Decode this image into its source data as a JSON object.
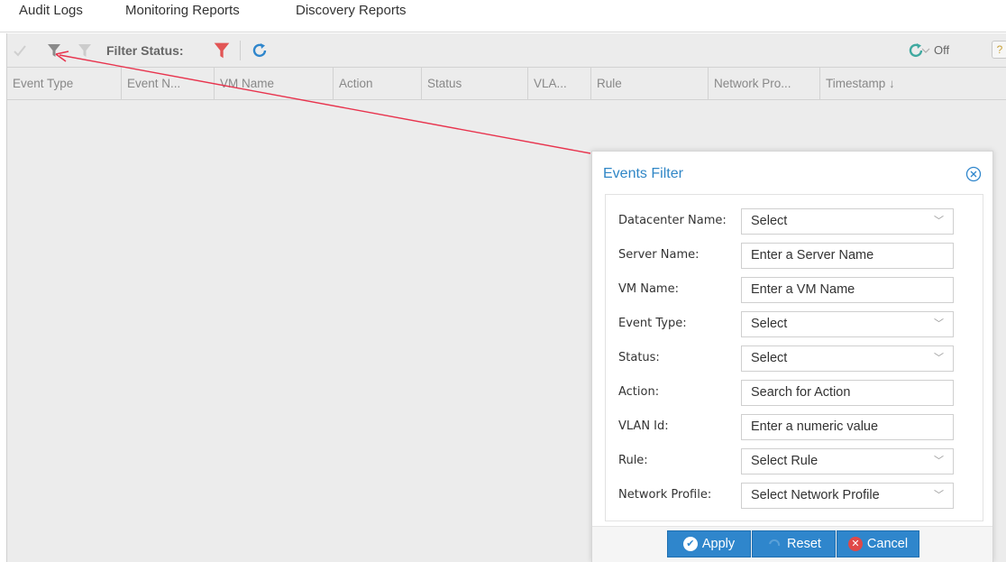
{
  "topnav": {
    "tabs": [
      "Audit Logs",
      "Monitoring Reports",
      "Discovery Reports"
    ]
  },
  "toolbar": {
    "filter_status_label": "Filter Status:",
    "off_label": "Off",
    "help_label": "?",
    "icons": [
      "checkmark-icon",
      "filter-icon",
      "clear-filter-icon",
      "red-filter-icon",
      "refresh-icon",
      "auto-refresh-icon"
    ]
  },
  "grid": {
    "columns": [
      "Event Type",
      "Event N...",
      "VM Name",
      "Action",
      "Status",
      "VLA...",
      "Rule",
      "Network Pro...",
      "Timestamp ↓"
    ]
  },
  "dialog": {
    "title": "Events Filter",
    "fields": [
      {
        "label": "Datacenter Name:",
        "value": "Select",
        "type": "select"
      },
      {
        "label": "Server Name:",
        "value": "Enter a Server Name",
        "type": "input"
      },
      {
        "label": "VM Name:",
        "value": "Enter a VM Name",
        "type": "input"
      },
      {
        "label": "Event Type:",
        "value": "Select",
        "type": "select"
      },
      {
        "label": "Status:",
        "value": "Select",
        "type": "select"
      },
      {
        "label": "Action:",
        "value": "Search for Action",
        "type": "input"
      },
      {
        "label": "VLAN Id:",
        "value": "Enter a numeric value",
        "type": "input"
      },
      {
        "label": "Rule:",
        "value": "Select Rule",
        "type": "select"
      },
      {
        "label": "Network Profile:",
        "value": "Select Network Profile",
        "type": "select"
      }
    ],
    "buttons": {
      "apply": "Apply",
      "reset": "Reset",
      "cancel": "Cancel"
    }
  },
  "colors": {
    "accent": "#2f86cc",
    "arrow": "#e8344e",
    "filter_red": "#e25555"
  }
}
